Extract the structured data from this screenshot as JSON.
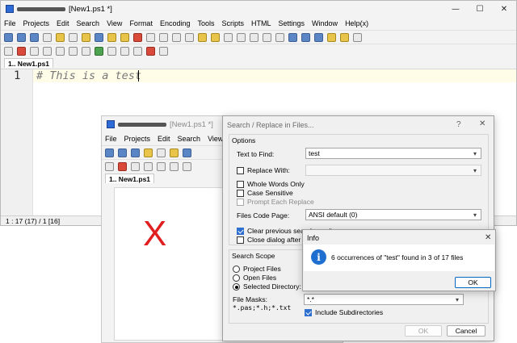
{
  "main_window": {
    "title": "[New1.ps1 *]",
    "controls": {
      "minimize": "—",
      "maximize": "☐",
      "close": "✕"
    },
    "menu": [
      "File",
      "Projects",
      "Edit",
      "Search",
      "View",
      "Format",
      "Encoding",
      "Tools",
      "Scripts",
      "HTML",
      "Settings",
      "Window",
      "Help(x)"
    ],
    "tab_label": "1.. New1.ps1",
    "line_number": "1",
    "code_text": "# This is a test",
    "status_text": "1 : 17 (17) / 1  [16]"
  },
  "second_window": {
    "title": "[New1.ps1 *]",
    "menu": [
      "File",
      "Projects",
      "Edit",
      "Search",
      "View"
    ],
    "tab_label": "1.. New1.ps1",
    "red_mark": "X"
  },
  "find_dialog": {
    "title": "Search / Replace in Files...",
    "help": "?",
    "close": "✕",
    "options_label": "Options",
    "text_to_find_label": "Text to Find:",
    "text_to_find_value": "test",
    "replace_with_label": "Replace With:",
    "replace_with_value": "",
    "whole_words_label": "Whole Words Only",
    "case_sensitive_label": "Case Sensitive",
    "prompt_replace_label": "Prompt Each Replace",
    "files_code_page_label": "Files Code Page:",
    "files_code_page_value": "ANSI default (0)",
    "clear_results_label": "Clear previous search results",
    "close_dialog_label": "Close dialog after search",
    "search_scope_label": "Search Scope",
    "project_files_label": "Project Files",
    "open_files_label": "Open Files",
    "selected_directory_label": "Selected Directory:",
    "file_masks_label": "File Masks:",
    "file_masks_hint": "*.pas;*.h;*.txt",
    "file_masks_value": "*.*",
    "include_subdirs_label": "Include Subdirectories",
    "ok_label": "OK",
    "cancel_label": "Cancel"
  },
  "info_dialog": {
    "title": "Info",
    "close": "✕",
    "icon": "i",
    "message": "6 occurrences of \"test\" found in 3 of 17 files",
    "ok_label": "OK"
  },
  "colors": {
    "accent": "#0067c0",
    "info_icon": "#1f6fd1",
    "red_mark": "#e02020",
    "code_text": "#777777",
    "current_line": "#fffde7"
  }
}
